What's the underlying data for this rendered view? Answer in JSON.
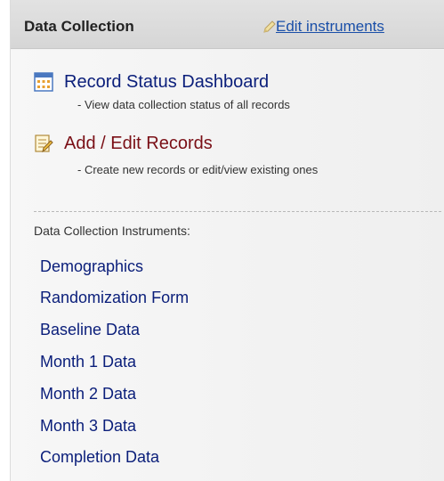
{
  "header": {
    "title": "Data Collection",
    "edit_instruments": "Edit instruments"
  },
  "main_links": [
    {
      "label": "Record Status Dashboard",
      "description": "- View data collection status of all records",
      "icon": "table-grid-icon"
    },
    {
      "label": "Add / Edit Records",
      "description": "- Create new records or edit/view existing ones",
      "icon": "edit-document-icon"
    }
  ],
  "instruments_label": "Data Collection Instruments:",
  "instruments": [
    "Demographics",
    "Randomization Form",
    "Baseline Data",
    "Month 1 Data",
    "Month 2 Data",
    "Month 3 Data",
    "Completion Data"
  ],
  "colors": {
    "link_blue": "#0a1e7a",
    "link_red": "#7a0f16",
    "edit_link": "#1a4fa8"
  }
}
